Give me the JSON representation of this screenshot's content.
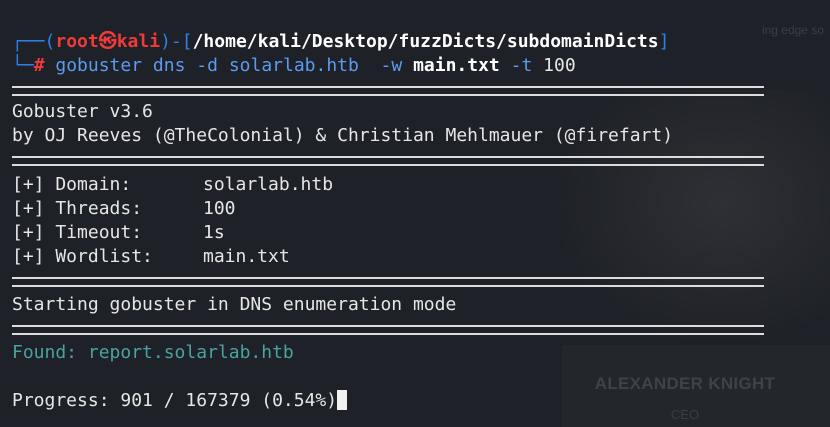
{
  "prompt": {
    "corner_top": "┌──(",
    "user": "root",
    "skull": "㉿",
    "host": "kali",
    "sep": ")-[",
    "path": "/home/kali/Desktop/fuzzDicts/subdomainDicts",
    "close": "]",
    "corner_bottom": "└─",
    "hash": "#"
  },
  "command": {
    "prog": "gobuster",
    "sub": "dns",
    "flag_d": "-d",
    "domain": "solarlab.htb",
    "flag_w": "-w",
    "wordlist": "main.txt",
    "flag_t": "-t",
    "threads": "100"
  },
  "banner": {
    "line1": "Gobuster v3.6",
    "line2": "by OJ Reeves (@TheColonial) & Christian Mehlmauer (@firefart)"
  },
  "config": [
    {
      "label": "[+] Domain:",
      "value": "solarlab.htb"
    },
    {
      "label": "[+] Threads:",
      "value": "100"
    },
    {
      "label": "[+] Timeout:",
      "value": "1s"
    },
    {
      "label": "[+] Wordlist:",
      "value": "main.txt"
    }
  ],
  "status": "Starting gobuster in DNS enumeration mode",
  "found": "Found: report.solarlab.htb",
  "progress": "Progress: 901 / 167379 (0.54%)",
  "background": {
    "name": "ALEXANDER KNIGHT",
    "role": "CEO",
    "top_text": "ing edge so"
  }
}
